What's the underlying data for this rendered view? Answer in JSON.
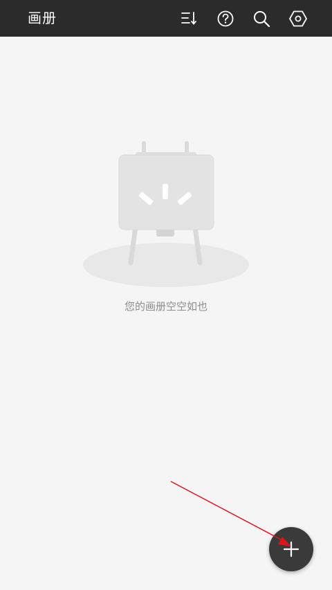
{
  "app_bar": {
    "title": "画册",
    "icons": [
      "sort-icon",
      "help-icon",
      "search-icon",
      "settings-icon"
    ]
  },
  "empty_state": {
    "message": "您的画册空空如也",
    "illustration": "easel-icon"
  },
  "fab": {
    "icon": "plus-icon"
  },
  "annotation": {
    "color": "#e0121b"
  },
  "colors": {
    "app_bar_bg": "#2b2b2b",
    "background": "#f5f5f5",
    "fab_bg": "#3a3a3a"
  }
}
